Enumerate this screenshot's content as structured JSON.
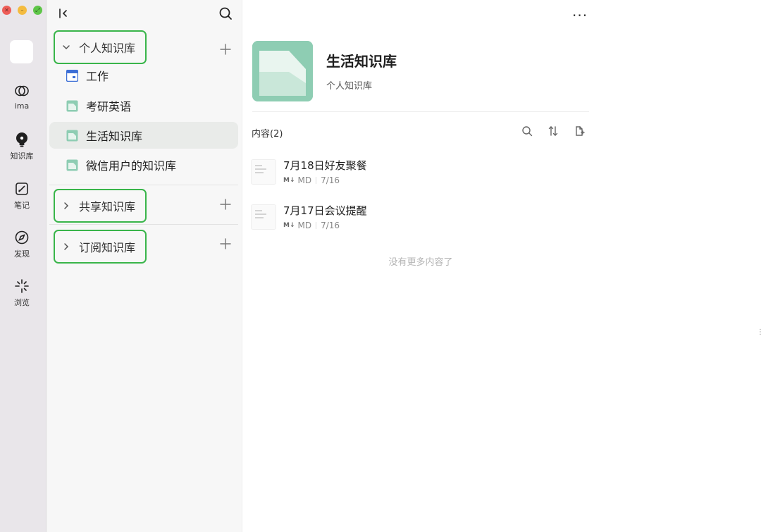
{
  "rail": {
    "items": [
      {
        "label": "ima",
        "icon": "ima-logo-icon"
      },
      {
        "label": "知识库",
        "icon": "knowledge-bulb-icon"
      },
      {
        "label": "笔记",
        "icon": "note-edit-icon"
      },
      {
        "label": "发现",
        "icon": "compass-icon"
      },
      {
        "label": "浏览",
        "icon": "sparkle-icon"
      }
    ]
  },
  "sidebar": {
    "groups": [
      {
        "label": "个人知识库",
        "expanded": true
      },
      {
        "label": "共享知识库",
        "expanded": false
      },
      {
        "label": "订阅知识库",
        "expanded": false
      }
    ],
    "items": [
      {
        "label": "工作"
      },
      {
        "label": "考研英语"
      },
      {
        "label": "生活知识库"
      },
      {
        "label": "微信用户的知识库"
      }
    ]
  },
  "main": {
    "title": "生活知识库",
    "subtitle": "个人知识库",
    "content_header": "内容(2)",
    "docs": [
      {
        "title": "7月18日好友聚餐",
        "type": "MD",
        "date": "7/16"
      },
      {
        "title": "7月17日会议提醒",
        "type": "MD",
        "date": "7/16"
      }
    ],
    "no_more": "没有更多内容了"
  },
  "colors": {
    "accent_green": "#39b54a",
    "cover_green": "#8ecdb3",
    "rail_bg": "#e9e6ea",
    "sidebar_bg": "#f7f7f7"
  }
}
